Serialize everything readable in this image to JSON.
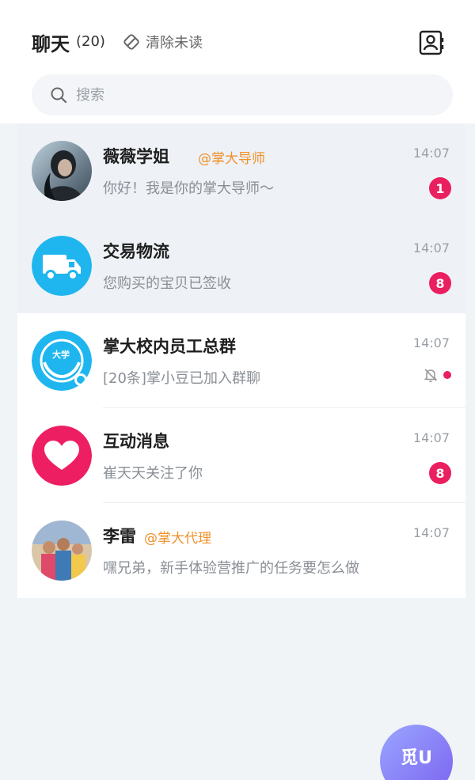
{
  "header": {
    "title": "聊天",
    "count": "(20)",
    "clear_unread_label": "清除未读"
  },
  "search": {
    "placeholder": "搜索"
  },
  "chats": [
    {
      "name": "薇薇学姐",
      "tag": "@掌大导师",
      "preview": "你好！我是你的掌大导师～",
      "time": "14:07",
      "badge": "1"
    },
    {
      "name": "交易物流",
      "tag": "",
      "preview": "您购买的宝贝已签收",
      "time": "14:07",
      "badge": "8"
    },
    {
      "name": "掌大校内员工总群",
      "tag": "",
      "preview": "[20条]掌小豆已加入群聊",
      "time": "14:07",
      "badge": "",
      "muted": true,
      "avatar_text": "大学"
    },
    {
      "name": "互动消息",
      "tag": "",
      "preview": "崔天天关注了你",
      "time": "14:07",
      "badge": "8"
    },
    {
      "name": "李雷",
      "tag": "@掌大代理",
      "preview": "嘿兄弟，新手体验营推广的任务要怎么做",
      "time": "14:07",
      "badge": ""
    }
  ],
  "fab": {
    "label": "觅U"
  },
  "colors": {
    "accent": "#ea1f5f",
    "tag": "#f0902a",
    "logistics": "#1fb6ef",
    "interaction": "#ee1e63"
  }
}
